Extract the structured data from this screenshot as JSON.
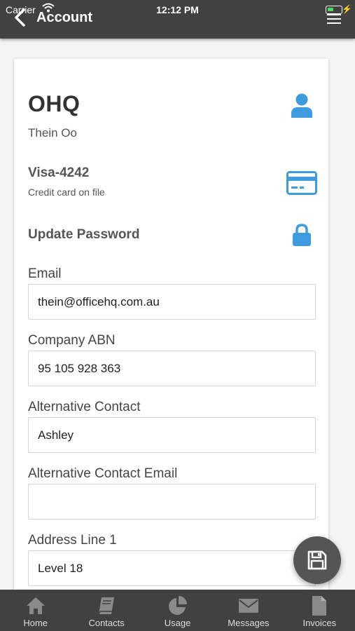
{
  "status_bar": {
    "carrier": "Carrier",
    "time": "12:12 PM"
  },
  "nav": {
    "title": "Account"
  },
  "account": {
    "company": "OHQ",
    "user": "Thein Oo",
    "card": {
      "title": "Visa-4242",
      "subtitle": "Credit card on file"
    },
    "update_password": "Update Password"
  },
  "fields": {
    "email": {
      "label": "Email",
      "value": "thein@officehq.com.au"
    },
    "abn": {
      "label": "Company ABN",
      "value": "95 105 928 363"
    },
    "alt_contact": {
      "label": "Alternative Contact",
      "value": "Ashley"
    },
    "alt_email": {
      "label": "Alternative Contact Email",
      "value": ""
    },
    "address1": {
      "label": "Address Line 1",
      "value": "Level 18"
    }
  },
  "tabs": [
    {
      "label": "Home",
      "icon": "home-icon"
    },
    {
      "label": "Contacts",
      "icon": "book-icon"
    },
    {
      "label": "Usage",
      "icon": "pie-chart-icon"
    },
    {
      "label": "Messages",
      "icon": "envelope-icon"
    },
    {
      "label": "Invoices",
      "icon": "file-icon"
    }
  ],
  "colors": {
    "accent": "#3f9be0",
    "bar": "#414141",
    "fab": "#555555"
  }
}
